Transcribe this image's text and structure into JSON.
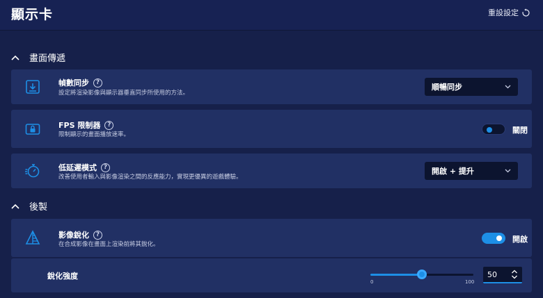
{
  "header": {
    "title": "顯示卡",
    "reset_label": "重設設定"
  },
  "sections": {
    "display": {
      "label": "畫面傳遞"
    },
    "post": {
      "label": "後製"
    }
  },
  "vsync": {
    "title": "幀數同步",
    "description": "設定將渲染影像與顯示器垂直同步所使用的方法。",
    "value": "順暢同步"
  },
  "fps_limiter": {
    "title": "FPS 限制器",
    "description": "限制顯示的畫面播放速率。",
    "state_label": "關閉",
    "enabled": false
  },
  "low_latency": {
    "title": "低延遲模式",
    "description": "改善使用者輸入與影像渲染之間的反應能力，實現更優異的遊戲體驗。",
    "value": "開啟 + 提升"
  },
  "sharpening": {
    "title": "影像銳化",
    "description": "在合成影像在畫面上渲染前將其銳化。",
    "state_label": "開啟",
    "enabled": true
  },
  "sharpness": {
    "label": "銳化強度",
    "min_label": "0",
    "max_label": "100",
    "value": "50",
    "fraction": 0.5
  },
  "colors": {
    "accent": "#1d8fe6",
    "card": "#213064",
    "background": "#16204a"
  },
  "icons": {
    "reset": "reset-icon",
    "vsync": "vsync-icon",
    "fps": "fps-lock-icon",
    "latency": "stopwatch-icon",
    "sharpen": "sharpen-icon"
  }
}
